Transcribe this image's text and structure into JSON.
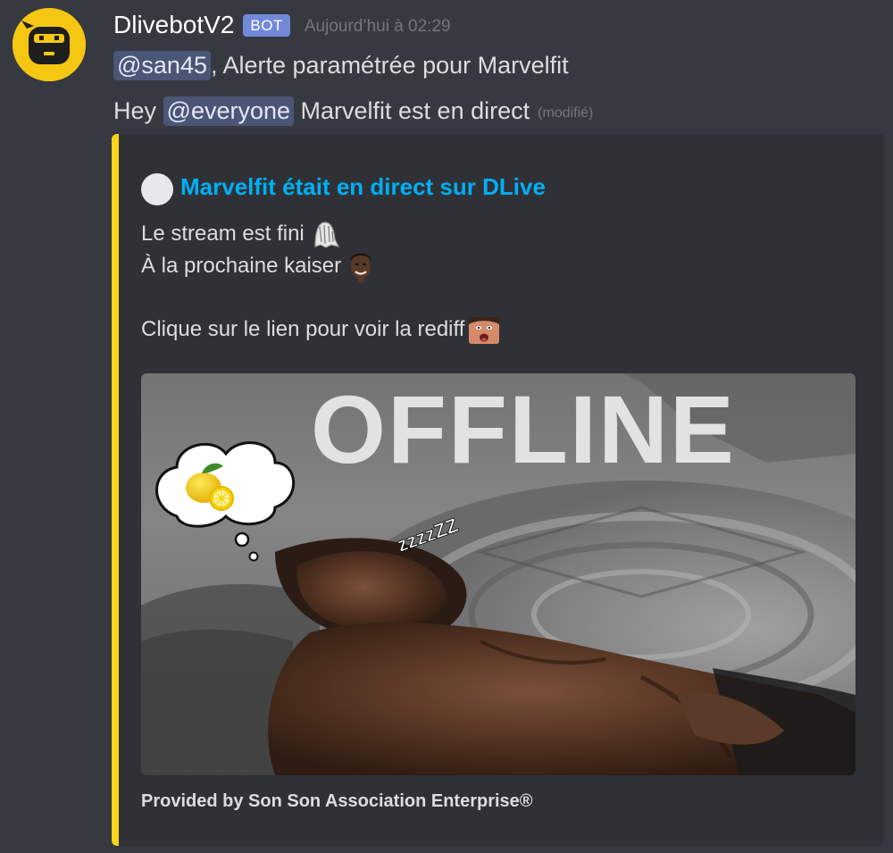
{
  "message": {
    "author": "DlivebotV2",
    "bot_tag": "BOT",
    "timestamp": "Aujourd’hui à 02:29",
    "line1": {
      "mention": "@san45",
      "text": ", Alerte paramétrée pour Marvelfit"
    },
    "line2": {
      "prefix": "Hey ",
      "mention": "@everyone",
      "text": " Marvelfit est en direct",
      "edited": "(modifié)"
    }
  },
  "embed": {
    "accent_color": "#fcd51d",
    "title": "Marvelfit était en direct sur DLive",
    "description": {
      "line1": "Le stream est fini",
      "line2": "À la prochaine kaiser",
      "line3": "Clique sur le lien pour voir la rediff"
    },
    "emojis": [
      "ghost-emoji",
      "face-emoji",
      "surprised-face-emoji"
    ],
    "image": {
      "overlay_text": "OFFLINE",
      "sleep_text": "zzzzZZ",
      "thought_icon": "lemon-icon"
    },
    "footer": "Provided by Son Son Association Enterprise®"
  }
}
